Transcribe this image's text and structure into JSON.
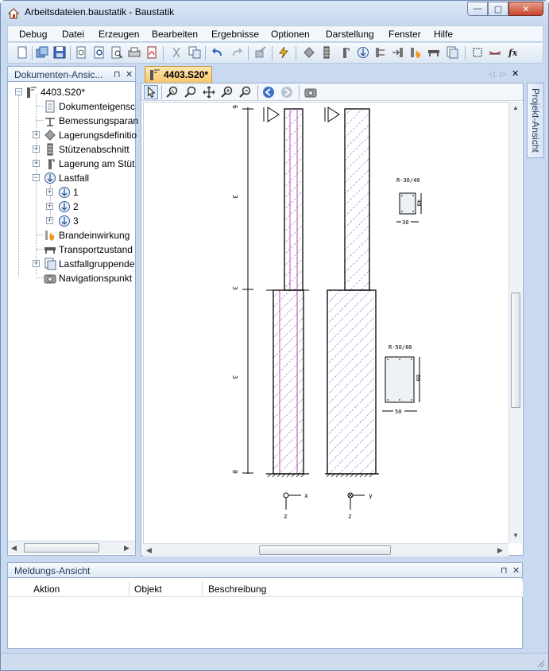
{
  "window": {
    "title": "Arbeitsdateien.baustatik - Baustatik",
    "minimize": "—",
    "maximize": "▢",
    "close": "✕"
  },
  "menu": [
    "Debug",
    "Datei",
    "Erzeugen",
    "Bearbeiten",
    "Ergebnisse",
    "Optionen",
    "Darstellung",
    "Fenster",
    "Hilfe"
  ],
  "doc_panel": {
    "title": "Dokumenten-Ansic...",
    "pin": "⊓",
    "close": "✕",
    "tree": [
      {
        "label": "4403.S20*",
        "icon": "column-model-icon"
      },
      {
        "label": "Dokumenteigensc",
        "icon": "document-properties-icon"
      },
      {
        "label": "Bemessungsparan",
        "icon": "design-parameters-icon"
      },
      {
        "label": "Lagerungsdefinitio",
        "icon": "support-definition-icon"
      },
      {
        "label": "Stützenabschnitt",
        "icon": "column-section-icon"
      },
      {
        "label": "Lagerung am Stüt",
        "icon": "column-support-icon"
      },
      {
        "label": "Lastfall",
        "icon": "load-case-icon"
      },
      {
        "label": "1",
        "icon": "load-case-icon"
      },
      {
        "label": "2",
        "icon": "load-case-icon"
      },
      {
        "label": "3",
        "icon": "load-case-icon"
      },
      {
        "label": "Brandeinwirkung",
        "icon": "fire-icon"
      },
      {
        "label": "Transportzustand",
        "icon": "transport-icon"
      },
      {
        "label": "Lastfallgruppende",
        "icon": "load-group-icon"
      },
      {
        "label": "Navigationspunkt",
        "icon": "camera-icon"
      }
    ]
  },
  "doc_tab": {
    "label": "4403.S20*"
  },
  "project_tab": {
    "label": "Projekt-Ansicht"
  },
  "drawing": {
    "dims": [
      "6",
      "3",
      "3",
      "3",
      "0"
    ],
    "section1": {
      "label": "R-30/40",
      "width": "30",
      "height": "40"
    },
    "section2": {
      "label": "R-50/80",
      "width": "50",
      "height": "80"
    },
    "axes": {
      "x": "x",
      "y": "y",
      "z1": "z",
      "z2": "z"
    }
  },
  "messages_panel": {
    "title": "Meldungs-Ansicht",
    "pin": "⊓",
    "close": "✕",
    "columns": [
      "Aktion",
      "Objekt",
      "Beschreibung"
    ]
  }
}
